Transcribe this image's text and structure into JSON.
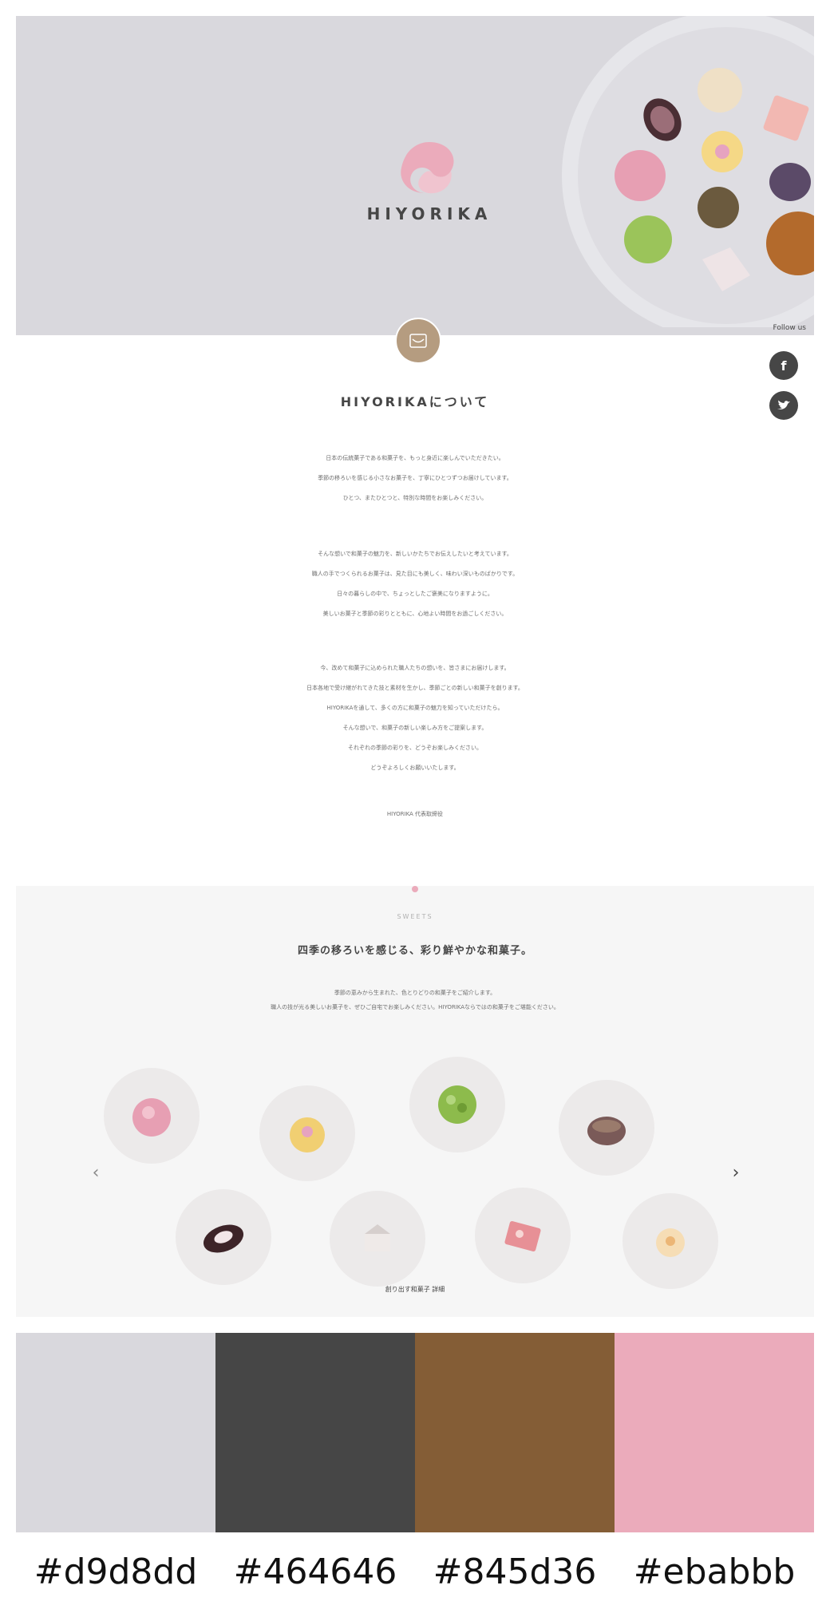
{
  "hero": {
    "logo_text": "HIYORIKA",
    "follow_label": "Follow us"
  },
  "about": {
    "title": "HIYORIKAについて",
    "paragraph1": [
      "日本の伝統菓子である和菓子を、もっと身近に楽しんでいただきたい。",
      "季節の移ろいを感じる小さなお菓子を、丁寧にひとつずつお届けしています。",
      "ひとつ、またひとつと、特別な時間をお楽しみください。"
    ],
    "paragraph2": [
      "そんな想いで和菓子の魅力を、新しいかたちでお伝えしたいと考えています。",
      "職人の手でつくられるお菓子は、見た目にも美しく、味わい深いものばかりです。",
      "日々の暮らしの中で、ちょっとしたご褒美になりますように。",
      "美しいお菓子と季節の彩りとともに、心地よい時間をお過ごしください。"
    ],
    "paragraph3": [
      "今、改めて和菓子に込められた職人たちの想いを、皆さまにお届けします。",
      "日本各地で受け継がれてきた技と素材を生かし、季節ごとの新しい和菓子を創ります。",
      "HIYORIKAを通して、多くの方に和菓子の魅力を知っていただけたら。",
      "そんな想いで、和菓子の新しい楽しみ方をご提案します。",
      "それぞれの季節の彩りを、どうぞお楽しみください。",
      "どうぞよろしくお願いいたします。"
    ],
    "signature": "HIYORIKA 代表取締役",
    "social": [
      {
        "name": "facebook",
        "glyph": "f"
      },
      {
        "name": "twitter",
        "glyph": "t"
      }
    ]
  },
  "sweets": {
    "eyebrow": "SWEETS",
    "title": "四季の移ろいを感じる、彩り鮮やかな和菓子。",
    "desc": [
      "季節の恵みから生まれた、色とりどりの和菓子をご紹介します。",
      "職人の技が光る美しいお菓子を、ぜひご自宅でお楽しみください。HIYORIKAならではの和菓子をご堪能ください。"
    ],
    "more_link": "創り出す和菓子 詳細",
    "prev_glyph": "‹",
    "next_glyph": "›"
  },
  "palette": [
    {
      "hex": "#d9d8dd",
      "label": "#d9d8dd"
    },
    {
      "hex": "#464646",
      "label": "#464646"
    },
    {
      "hex": "#845d36",
      "label": "#845d36"
    },
    {
      "hex": "#ebabbb",
      "label": "#ebabbb"
    }
  ]
}
